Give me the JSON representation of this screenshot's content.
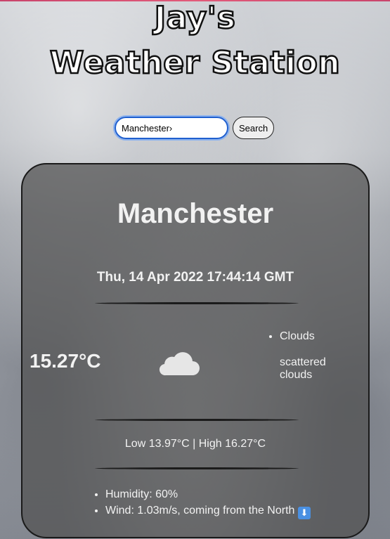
{
  "header": {
    "title_line1": "Jay's",
    "title_line2": "Weather Station"
  },
  "search": {
    "value": "Manchester›",
    "button_label": "Search"
  },
  "weather": {
    "city": "Manchester",
    "datetime": "Thu, 14 Apr 2022 17:44:14 GMT",
    "temperature": "15.27°C",
    "icon": "cloud-icon",
    "condition": "Clouds",
    "description": "scattered clouds",
    "low_high": "Low 13.97°C | High 16.27°C",
    "humidity": "Humidity: 60%",
    "wind": "Wind: 1.03m/s, coming from the North",
    "wind_arrow": "⬇"
  },
  "colors": {
    "card_bg": "#505050",
    "accent_border": "#1f5fcf",
    "top_border": "#c9446b"
  }
}
